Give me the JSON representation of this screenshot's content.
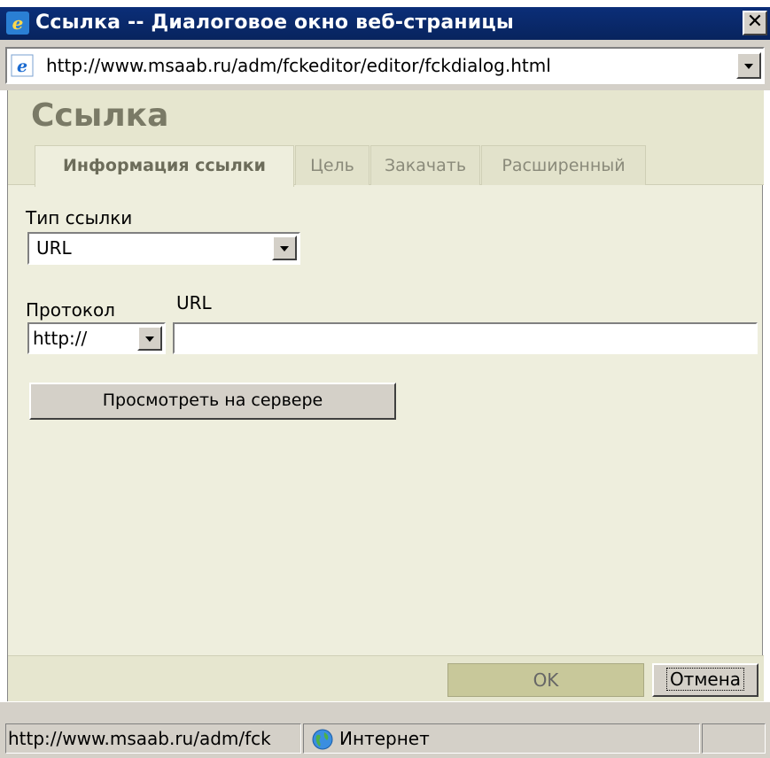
{
  "window": {
    "title": "Ссылка -- Диалоговое окно веб-страницы",
    "address": "http://www.msaab.ru/adm/fckeditor/editor/fckdialog.html",
    "icon": "ie-icon"
  },
  "dialog": {
    "title": "Ссылка",
    "tabs": [
      {
        "label": "Информация ссылки",
        "selected": true
      },
      {
        "label": "Цель",
        "selected": false
      },
      {
        "label": "Закачать",
        "selected": false
      },
      {
        "label": "Расширенный",
        "selected": false
      }
    ],
    "link_type": {
      "label": "Тип ссылки",
      "value": "URL"
    },
    "protocol": {
      "label": "Протокол",
      "value": "http://"
    },
    "url": {
      "label": "URL",
      "value": ""
    },
    "browse_button": "Просмотреть на сервере",
    "ok_button": "OK",
    "cancel_button": "Отмена"
  },
  "statusbar": {
    "url": "http://www.msaab.ru/adm/fck",
    "zone": "Интернет"
  },
  "colors": {
    "titlebar": "#0a2a6e",
    "dialog_bg": "#eeeedd",
    "header_bg": "#e6e6cf",
    "ok_bg": "#c8c89a"
  }
}
